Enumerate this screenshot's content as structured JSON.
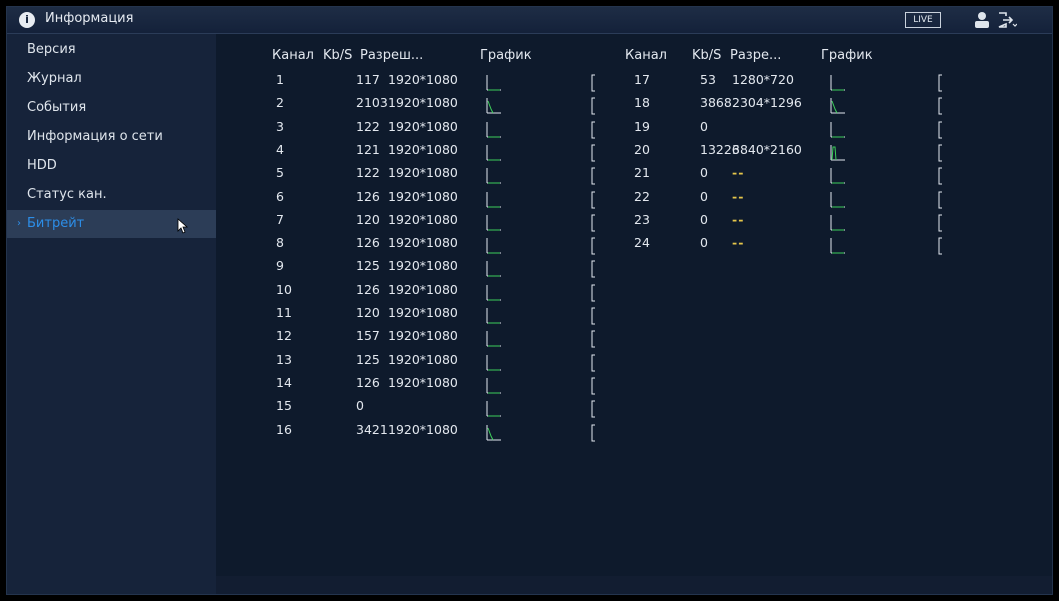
{
  "header": {
    "title": "Информация",
    "live_label": "LIVE",
    "icons": [
      "info-icon",
      "user-icon",
      "logout-icon"
    ]
  },
  "sidebar": {
    "items": [
      {
        "label": "Версия"
      },
      {
        "label": "Журнал"
      },
      {
        "label": "События"
      },
      {
        "label": "Информация о сети"
      },
      {
        "label": "HDD"
      },
      {
        "label": "Статус кан."
      },
      {
        "label": "Битрейт",
        "active": true
      }
    ]
  },
  "table": {
    "headers": {
      "channel": "Канал",
      "kbs": "Kb/S",
      "res_left": "Разреш...",
      "res_right": "Разре...",
      "graph": "График"
    },
    "left_rows": [
      {
        "ch": "1",
        "kbs": "117",
        "res": "1920*1080"
      },
      {
        "ch": "2",
        "kbs": "2103",
        "res": "1920*1080"
      },
      {
        "ch": "3",
        "kbs": "122",
        "res": "1920*1080"
      },
      {
        "ch": "4",
        "kbs": "121",
        "res": "1920*1080"
      },
      {
        "ch": "5",
        "kbs": "122",
        "res": "1920*1080"
      },
      {
        "ch": "6",
        "kbs": "126",
        "res": "1920*1080"
      },
      {
        "ch": "7",
        "kbs": "120",
        "res": "1920*1080"
      },
      {
        "ch": "8",
        "kbs": "126",
        "res": "1920*1080"
      },
      {
        "ch": "9",
        "kbs": "125",
        "res": "1920*1080"
      },
      {
        "ch": "10",
        "kbs": "126",
        "res": "1920*1080"
      },
      {
        "ch": "11",
        "kbs": "120",
        "res": "1920*1080"
      },
      {
        "ch": "12",
        "kbs": "157",
        "res": "1920*1080"
      },
      {
        "ch": "13",
        "kbs": "125",
        "res": "1920*1080"
      },
      {
        "ch": "14",
        "kbs": "126",
        "res": "1920*1080"
      },
      {
        "ch": "15",
        "kbs": "0",
        "res": ""
      },
      {
        "ch": "16",
        "kbs": "3421",
        "res": "1920*1080"
      }
    ],
    "right_rows": [
      {
        "ch": "17",
        "kbs": "53",
        "res": "1280*720"
      },
      {
        "ch": "18",
        "kbs": "3868",
        "res": "2304*1296"
      },
      {
        "ch": "19",
        "kbs": "0",
        "res": ""
      },
      {
        "ch": "20",
        "kbs": "13226",
        "res": "3840*2160"
      },
      {
        "ch": "21",
        "kbs": "0",
        "res": "--"
      },
      {
        "ch": "22",
        "kbs": "0",
        "res": "--"
      },
      {
        "ch": "23",
        "kbs": "0",
        "res": "--"
      },
      {
        "ch": "24",
        "kbs": "0",
        "res": "--"
      }
    ]
  },
  "colors": {
    "accent": "#2d8ee8",
    "graph_line": "#3ccf5a",
    "dash": "#e5c64a"
  }
}
